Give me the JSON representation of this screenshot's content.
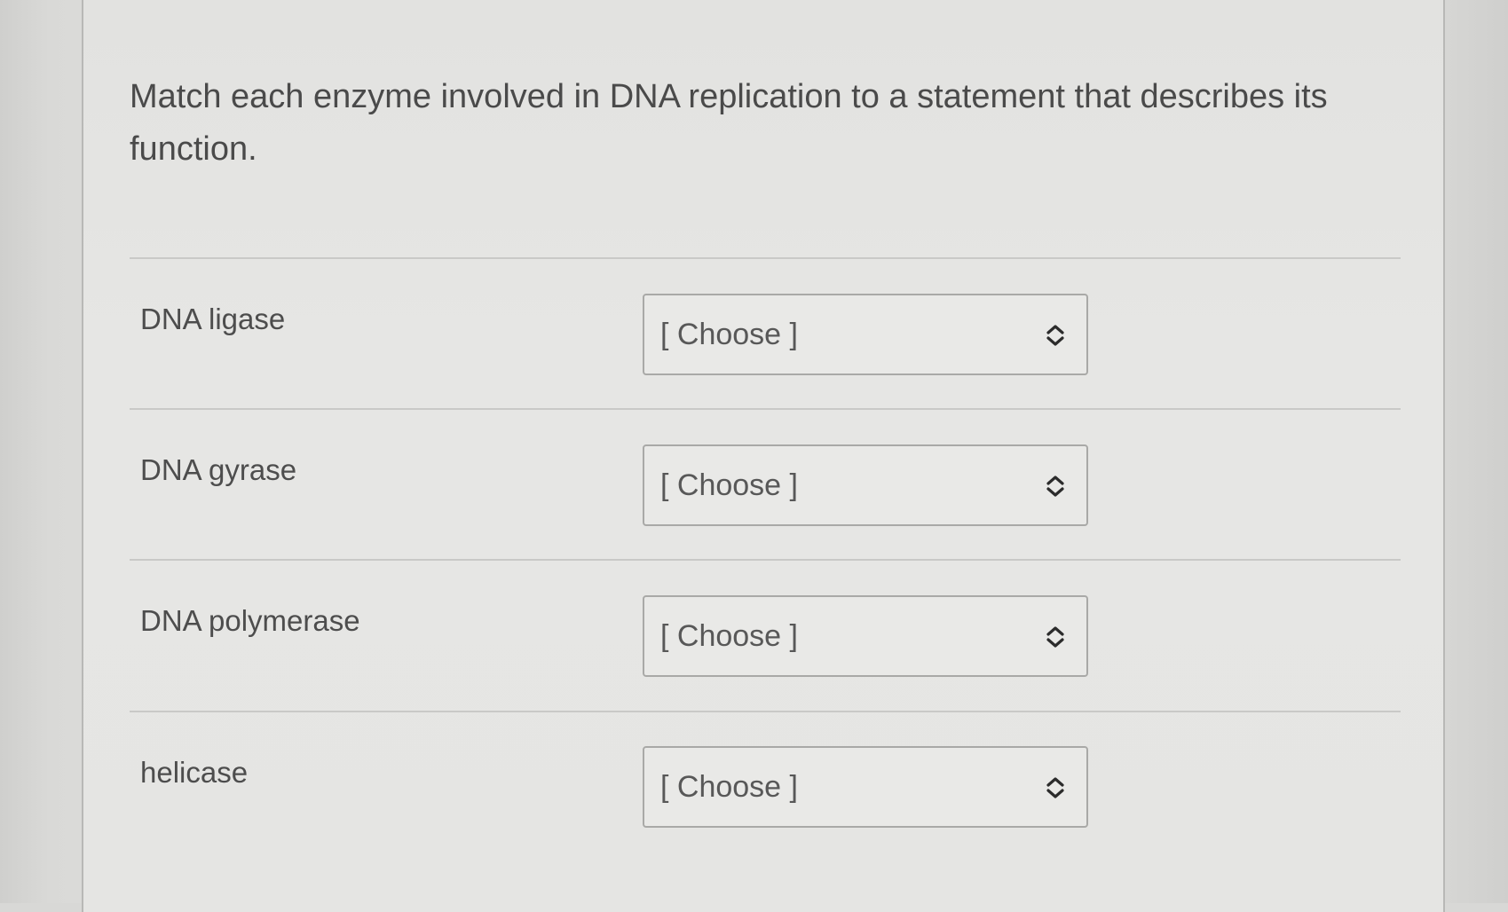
{
  "question": {
    "text": "Match each enzyme involved in DNA replication to a statement that describes its function."
  },
  "rows": [
    {
      "label": "DNA ligase",
      "select_value": "[ Choose ]",
      "icon": "up-down-chevron-icon"
    },
    {
      "label": "DNA gyrase",
      "select_value": "[ Choose ]",
      "icon": "up-down-chevron-icon"
    },
    {
      "label": "DNA polymerase",
      "select_value": "[ Choose ]",
      "icon": "up-down-chevron-icon"
    },
    {
      "label": "helicase",
      "select_value": "[ Choose ]",
      "icon": "up-down-chevron-icon"
    }
  ],
  "colors": {
    "panel_background": "#e4e4e2",
    "text": "#4a4a4a",
    "select_border": "#a9a9a7",
    "divider": "#c9c9c7"
  }
}
